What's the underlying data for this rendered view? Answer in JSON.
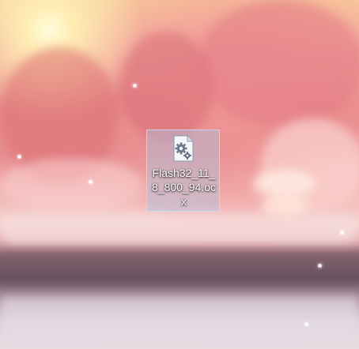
{
  "desktop": {
    "wallpaper": "sunlit-pink-forest-stream",
    "colors": {
      "selection_fill": "#aac3e1",
      "selection_border": "#c8dcf5",
      "label_text": "#ffffff"
    }
  },
  "file": {
    "icon": "settings-file-icon",
    "name_display": "Flash32_11_\n8_800_94.oc\nx",
    "selected": true
  }
}
